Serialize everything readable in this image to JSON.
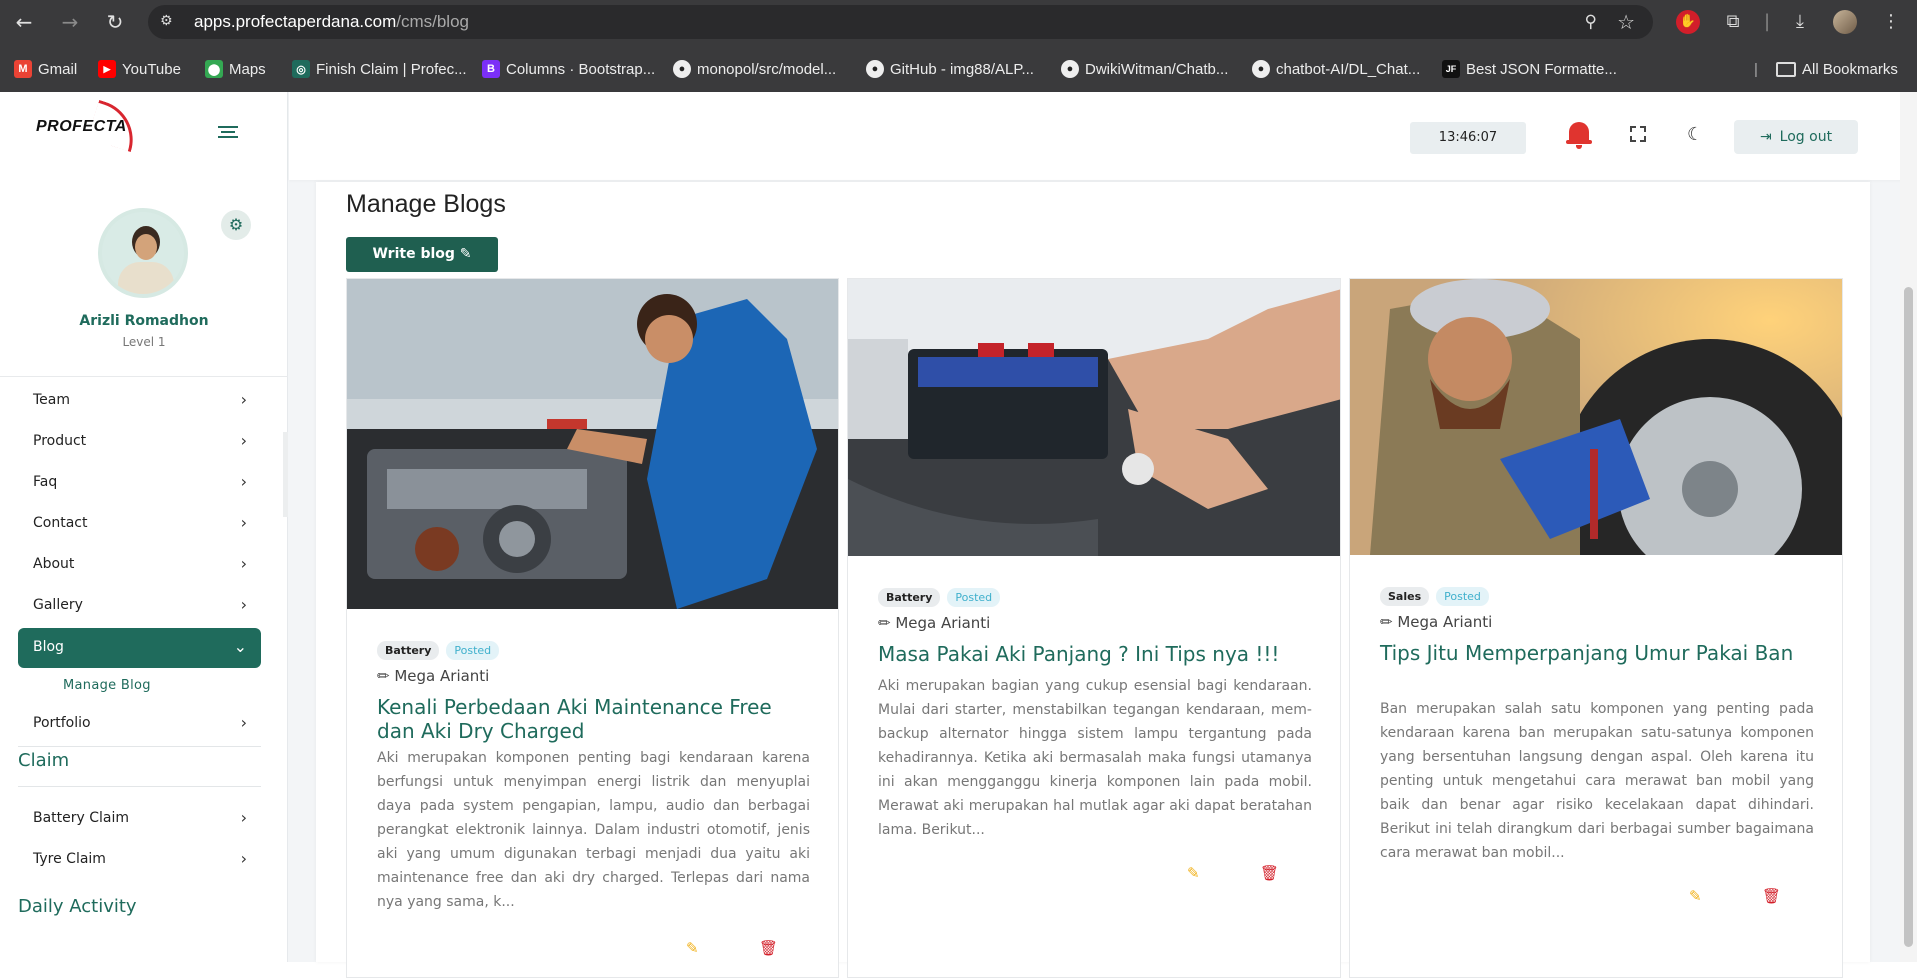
{
  "browser": {
    "url_host": "apps.profectaperdana.com",
    "url_path": "/cms/blog",
    "bookmarks": [
      {
        "label": "Gmail",
        "icon": "gmail-icon",
        "color": "#ea4335",
        "glyph": "M"
      },
      {
        "label": "YouTube",
        "icon": "youtube-icon",
        "color": "#ff0000",
        "glyph": "▶"
      },
      {
        "label": "Maps",
        "icon": "maps-icon",
        "color": "#34a853",
        "glyph": "⬤"
      },
      {
        "label": "Finish Claim | Profec...",
        "icon": "globe-icon",
        "color": "#1f6b5c",
        "glyph": "◎"
      },
      {
        "label": "Columns · Bootstrap...",
        "icon": "bootstrap-icon",
        "color": "#7b2ff7",
        "glyph": "B"
      },
      {
        "label": "monopol/src/model...",
        "icon": "github-icon",
        "color": "#ffffff",
        "glyph": "●"
      },
      {
        "label": "GitHub - img88/ALP...",
        "icon": "github-icon",
        "color": "#ffffff",
        "glyph": "●"
      },
      {
        "label": "DwikiWitman/Chatb...",
        "icon": "github-icon",
        "color": "#ffffff",
        "glyph": "●"
      },
      {
        "label": "chatbot-AI/DL_Chat...",
        "icon": "github-icon",
        "color": "#ffffff",
        "glyph": "●"
      },
      {
        "label": "Best JSON Formatte...",
        "icon": "jf-icon",
        "color": "#111111",
        "glyph": "JF"
      }
    ],
    "all_bookmarks": "All Bookmarks"
  },
  "header": {
    "time": "13:46:07",
    "logout_label": "Log out",
    "logo_text": "PROFECTA"
  },
  "profile": {
    "name": "Arizli Romadhon",
    "level": "Level 1"
  },
  "menu": {
    "items": [
      {
        "label": "Team"
      },
      {
        "label": "Product"
      },
      {
        "label": "Faq"
      },
      {
        "label": "Contact"
      },
      {
        "label": "About"
      },
      {
        "label": "Gallery"
      },
      {
        "label": "Blog"
      },
      {
        "label": "Portfolio"
      }
    ],
    "blog_sub": "Manage Blog",
    "claim_title": "Claim",
    "claim_items": [
      {
        "label": "Battery Claim"
      },
      {
        "label": "Tyre Claim"
      }
    ],
    "daily_title": "Daily Activity"
  },
  "main": {
    "title": "Manage Blogs",
    "write_label": "Write blog",
    "cards": [
      {
        "category": "Battery",
        "status": "Posted",
        "author": "Mega Arianti",
        "title": "Kenali Perbedaan Aki Maintenance Free dan Aki Dry Charged",
        "excerpt": "Aki merupakan komponen penting bagi kendaraan karena berfungsi untuk menyimpan energi listrik dan menyuplai daya pada system pengapian, lampu, audio dan berbagai perangkat elektronik lainnya. Dalam industri otomotif, jenis aki yang umum digunakan terbagi menjadi dua yaitu aki maintenance free dan aki dry charged. Terlepas dari nama nya yang sama, k..."
      },
      {
        "category": "Battery",
        "status": "Posted",
        "author": "Mega Arianti",
        "title": "Masa Pakai Aki Panjang ? Ini Tips nya !!!",
        "excerpt": "Aki merupakan bagian yang cukup esensial bagi kendaraan. Mulai dari starter, menstabilkan tegangan kendaraan, mem-backup alternator hingga sistem lampu tergantung pada kehadirannya. Ketika aki bermasalah maka fungsi utamanya ini akan mengganggu kinerja komponen lain pada mobil. Merawat aki merupakan hal mutlak agar aki dapat beratahan lama. Berikut..."
      },
      {
        "category": "Sales",
        "status": "Posted",
        "author": "Mega Arianti",
        "title": "Tips Jitu Memperpanjang Umur Pakai Ban",
        "excerpt": "Ban merupakan salah satu komponen yang penting pada kendaraan karena ban merupakan satu-satunya komponen yang bersentuhan langsung dengan aspal. Oleh karena itu penting untuk mengetahui cara merawat ban mobil yang baik dan benar agar risiko kecelakaan dapat dihindari. Berikut ini telah dirangkum dari berbagai sumber bagaimana cara merawat ban mobil..."
      }
    ]
  }
}
